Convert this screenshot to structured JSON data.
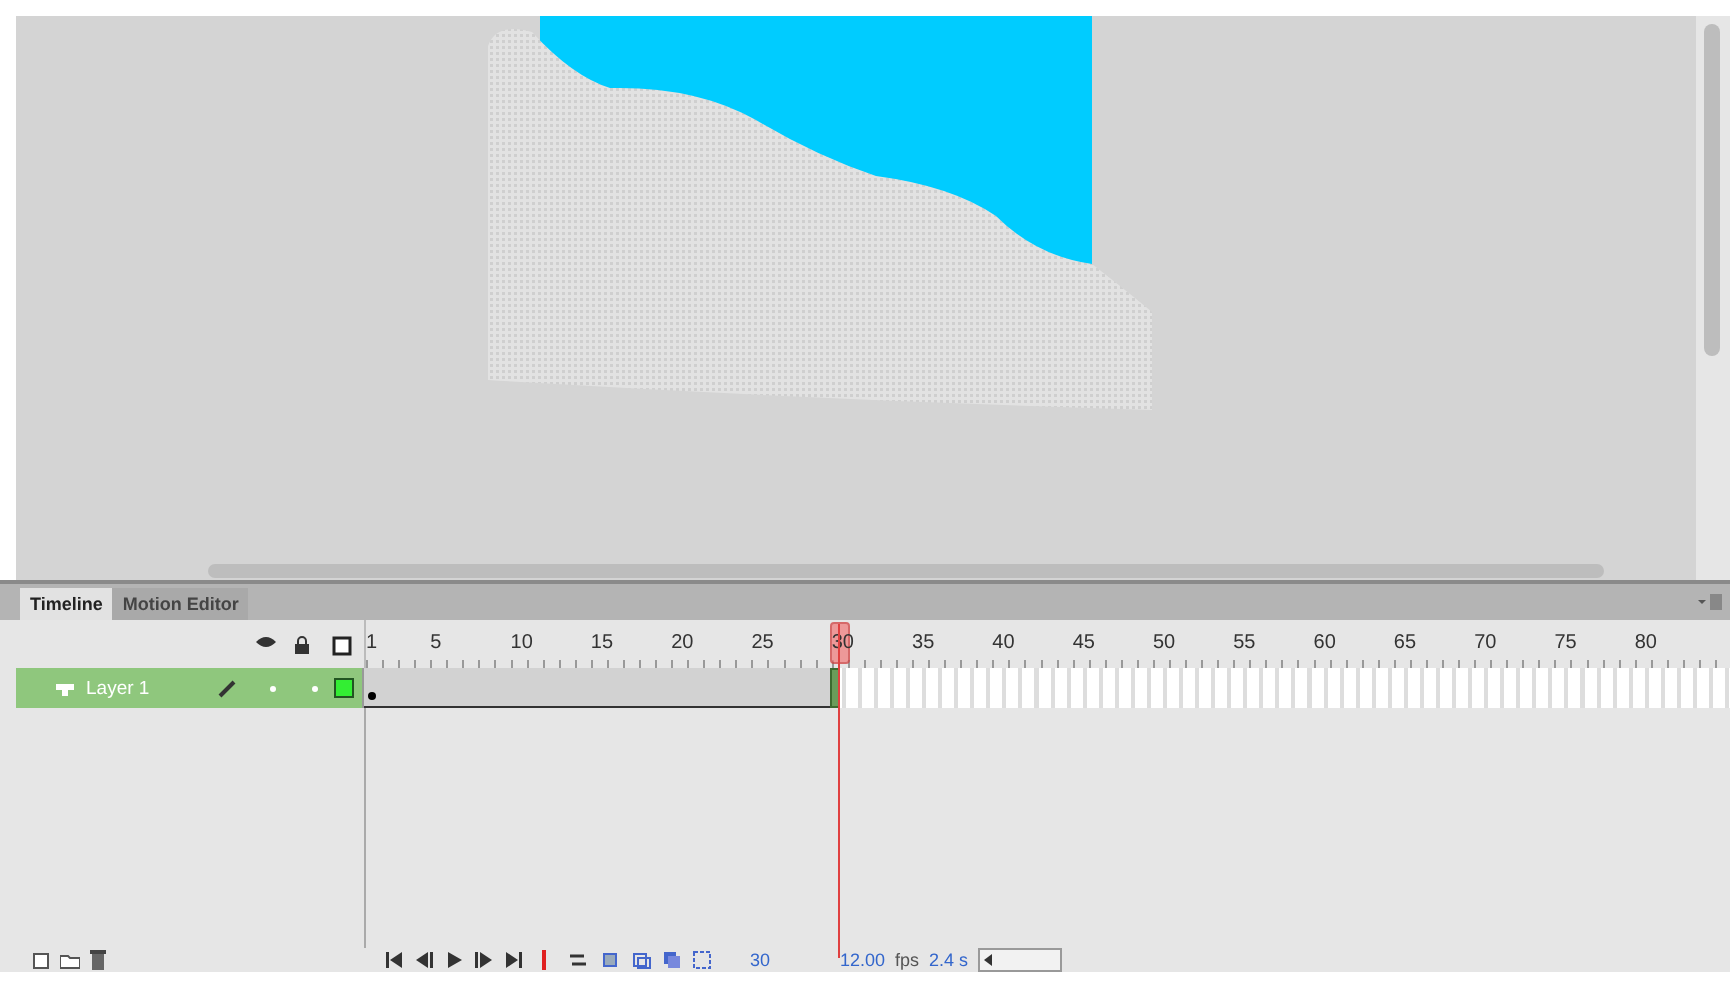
{
  "panel_tabs": [
    {
      "label": "Timeline",
      "selected": true
    },
    {
      "label": "Motion Editor",
      "selected": false
    }
  ],
  "ruler": [
    {
      "label": "1",
      "selected": false
    },
    {
      "label": "5",
      "selected": false
    },
    {
      "label": "10",
      "selected": false
    },
    {
      "label": "15",
      "selected": false
    },
    {
      "label": "20",
      "selected": false
    },
    {
      "label": "25",
      "selected": false
    },
    {
      "label": "30",
      "selected": true
    },
    {
      "label": "35",
      "selected": false
    },
    {
      "label": "40",
      "selected": false
    },
    {
      "label": "45",
      "selected": false
    },
    {
      "label": "50",
      "selected": false
    },
    {
      "label": "55",
      "selected": false
    },
    {
      "label": "60",
      "selected": false
    },
    {
      "label": "65",
      "selected": false
    },
    {
      "label": "70",
      "selected": false
    },
    {
      "label": "75",
      "selected": false
    },
    {
      "label": "80",
      "selected": false
    }
  ],
  "layers": [
    {
      "name": "Layer 1",
      "selected": true,
      "color": "#33ee33"
    }
  ],
  "status": {
    "current_frame": "30",
    "fps_value": "12.00",
    "fps_unit": "fps",
    "elapsed": "2.4 s"
  }
}
